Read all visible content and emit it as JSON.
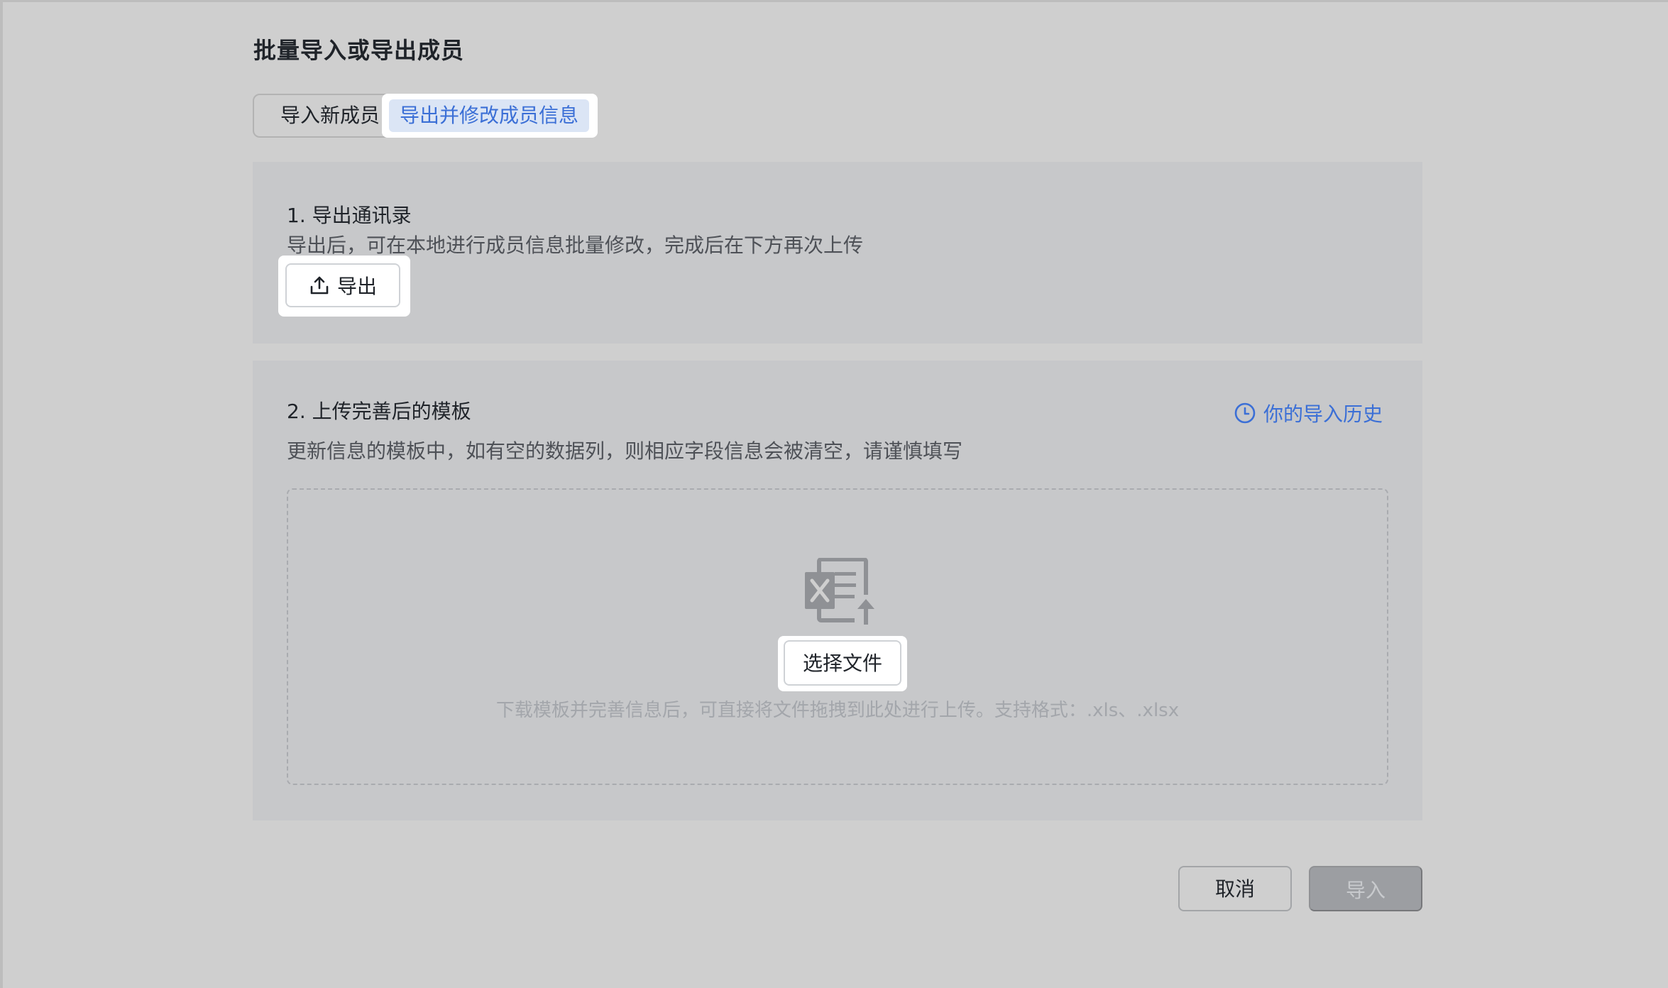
{
  "page": {
    "title": "批量导入或导出成员"
  },
  "tabs": {
    "import_label": "导入新成员",
    "export_label": "导出并修改成员信息",
    "active": "export"
  },
  "step1": {
    "title": "1. 导出通讯录",
    "description": "导出后，可在本地进行成员信息批量修改，完成后在下方再次上传",
    "export_button": "导出",
    "export_icon": "upload-icon"
  },
  "step2": {
    "title": "2. 上传完善后的模板",
    "description": "更新信息的模板中，如有空的数据列，则相应字段信息会被清空，请谨慎填写",
    "history_link": "你的导入历史",
    "history_icon": "clock-icon",
    "dropzone": {
      "icon": "excel-file-upload-icon",
      "choose_button": "选择文件",
      "hint": "下载模板并完善信息后，可直接将文件拖拽到此处进行上传。支持格式：.xls、.xlsx"
    }
  },
  "footer": {
    "cancel_label": "取消",
    "import_label": "导入",
    "import_disabled": true
  },
  "colors": {
    "accent": "#3b6fd6",
    "background": "#cfcfcf",
    "panel": "#c7c8ca",
    "disabled_button": "#9c9ea2"
  }
}
